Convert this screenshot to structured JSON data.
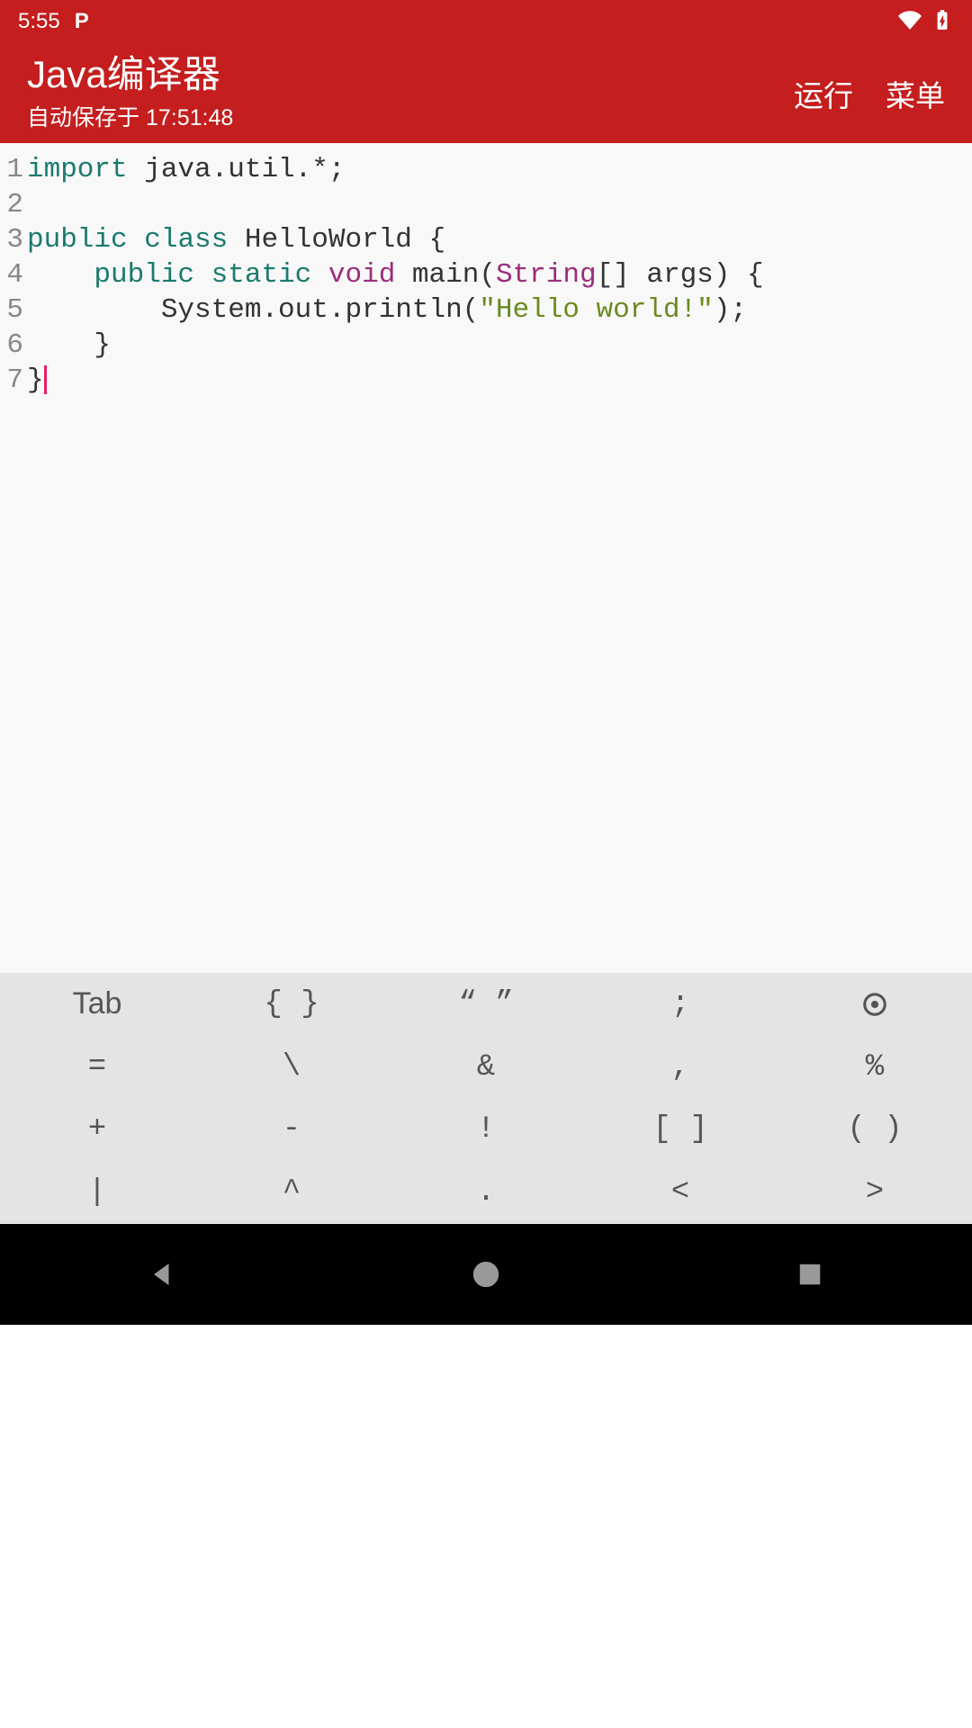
{
  "status_bar": {
    "time": "5:55",
    "app_indicator": "P"
  },
  "app_bar": {
    "title": "Java编译器",
    "subtitle": "自动保存于 17:51:48",
    "run_label": "运行",
    "menu_label": "菜单"
  },
  "editor": {
    "gutter": [
      "1",
      "2",
      "3",
      "4",
      "5",
      "6",
      "7"
    ],
    "code_tokens": [
      [
        {
          "t": "kw",
          "v": "import"
        },
        {
          "t": "",
          "v": " java.util.*;"
        }
      ],
      [],
      [
        {
          "t": "kw",
          "v": "public"
        },
        {
          "t": "",
          "v": " "
        },
        {
          "t": "kw",
          "v": "class"
        },
        {
          "t": "",
          "v": " HelloWorld {"
        }
      ],
      [
        {
          "t": "",
          "v": "    "
        },
        {
          "t": "kw",
          "v": "public"
        },
        {
          "t": "",
          "v": " "
        },
        {
          "t": "kw",
          "v": "static"
        },
        {
          "t": "",
          "v": " "
        },
        {
          "t": "prim",
          "v": "void"
        },
        {
          "t": "",
          "v": " main("
        },
        {
          "t": "cls",
          "v": "String"
        },
        {
          "t": "",
          "v": "[] args) {"
        }
      ],
      [
        {
          "t": "",
          "v": "        System.out.println("
        },
        {
          "t": "str",
          "v": "\"Hello world!\""
        },
        {
          "t": "",
          "v": ");"
        }
      ],
      [
        {
          "t": "",
          "v": "    }"
        }
      ],
      [
        {
          "t": "",
          "v": "}"
        },
        {
          "t": "cursor",
          "v": ""
        }
      ]
    ]
  },
  "symbol_bar": {
    "keys": [
      "Tab",
      "{ }",
      "“ ”",
      ";",
      "⊙",
      "=",
      "\\",
      "&",
      ",",
      "%",
      "+",
      "-",
      "!",
      "[ ]",
      "( )",
      "|",
      "^",
      ".",
      "<",
      ">"
    ]
  }
}
